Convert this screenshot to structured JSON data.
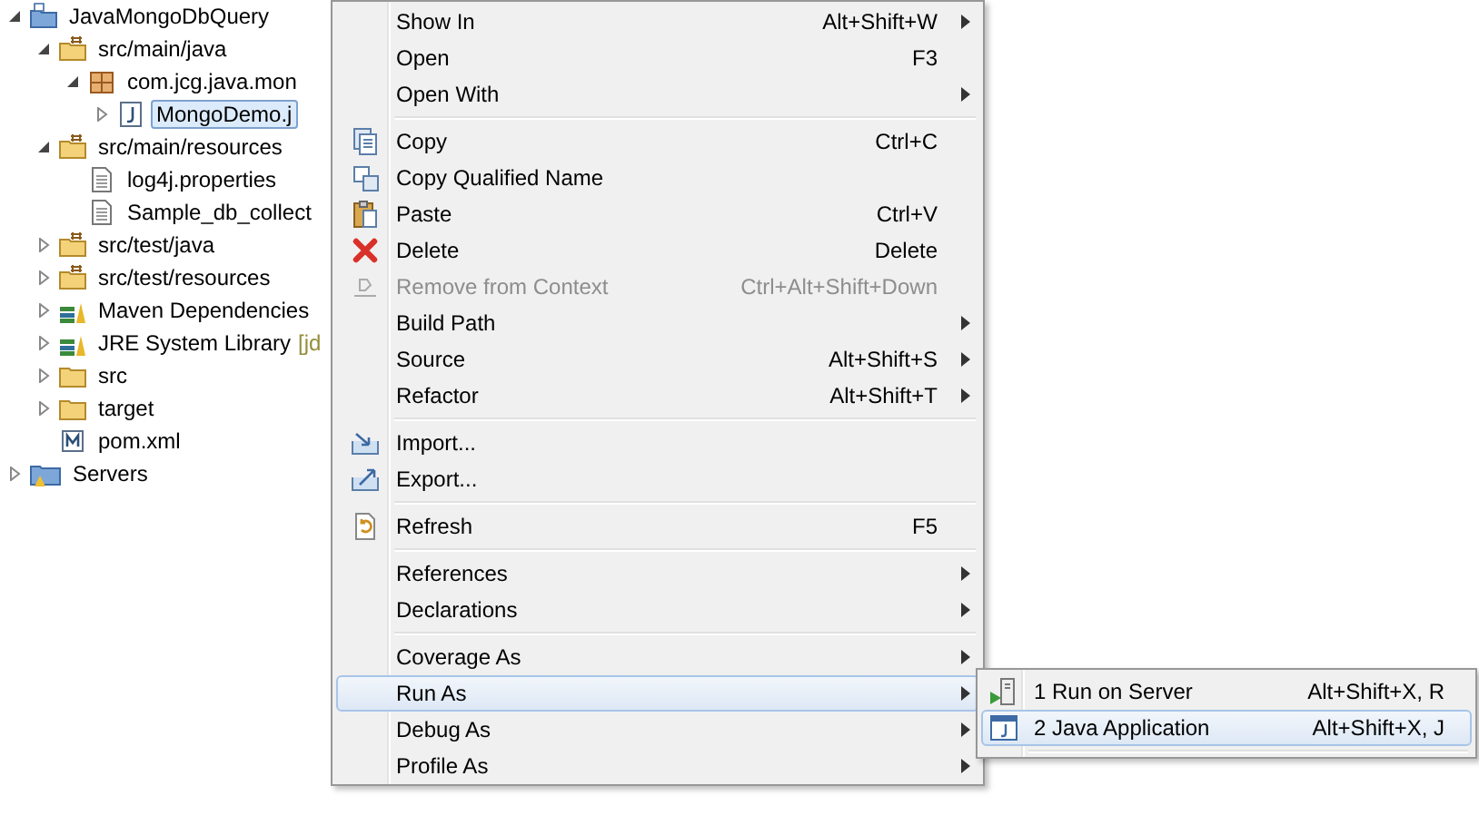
{
  "tree": [
    {
      "label": "JavaMongoDbQuery",
      "kind": "project",
      "expanded": true,
      "selected": false,
      "children": [
        {
          "label": "src/main/java",
          "kind": "source-folder",
          "expanded": true,
          "selected": false,
          "children": [
            {
              "label": "com.jcg.java.mon",
              "kind": "package",
              "expanded": true,
              "selected": false,
              "children": [
                {
                  "label": "MongoDemo.j",
                  "kind": "java-file",
                  "expanded": false,
                  "selected": true
                }
              ]
            }
          ]
        },
        {
          "label": "src/main/resources",
          "kind": "source-folder",
          "expanded": true,
          "selected": false,
          "children": [
            {
              "label": "log4j.properties",
              "kind": "file",
              "selected": false
            },
            {
              "label": "Sample_db_collect",
              "kind": "file",
              "selected": false
            }
          ]
        },
        {
          "label": "src/test/java",
          "kind": "source-folder",
          "expanded": false,
          "selected": false
        },
        {
          "label": "src/test/resources",
          "kind": "source-folder",
          "expanded": false,
          "selected": false
        },
        {
          "label": "Maven Dependencies",
          "kind": "library",
          "expanded": false,
          "selected": false
        },
        {
          "label": "JRE System Library",
          "decoration": "[jd",
          "kind": "library",
          "expanded": false,
          "selected": false
        },
        {
          "label": "src",
          "kind": "folder",
          "expanded": false,
          "selected": false
        },
        {
          "label": "target",
          "kind": "folder",
          "expanded": false,
          "selected": false
        },
        {
          "label": "pom.xml",
          "kind": "maven-file",
          "selected": false
        }
      ]
    },
    {
      "label": "Servers",
      "kind": "servers",
      "expanded": false,
      "selected": false
    }
  ],
  "context_menu": [
    {
      "kind": "plain",
      "label": "Show In",
      "shortcut": "Alt+Shift+W",
      "submenu": true,
      "disabled": false,
      "selected": false
    },
    {
      "kind": "plain",
      "label": "Open",
      "shortcut": "F3",
      "submenu": false,
      "disabled": false,
      "selected": false
    },
    {
      "kind": "plain",
      "label": "Open With",
      "submenu": true,
      "disabled": false,
      "selected": false
    },
    {
      "kind": "separator"
    },
    {
      "kind": "copy",
      "label": "Copy",
      "shortcut": "Ctrl+C",
      "submenu": false,
      "disabled": false,
      "selected": false
    },
    {
      "kind": "copy-qualified",
      "label": "Copy Qualified Name",
      "submenu": false,
      "disabled": false,
      "selected": false
    },
    {
      "kind": "paste",
      "label": "Paste",
      "shortcut": "Ctrl+V",
      "submenu": false,
      "disabled": false,
      "selected": false
    },
    {
      "kind": "delete",
      "label": "Delete",
      "shortcut": "Delete",
      "submenu": false,
      "disabled": false,
      "selected": false
    },
    {
      "kind": "remove-context",
      "label": "Remove from Context",
      "shortcut": "Ctrl+Alt+Shift+Down",
      "submenu": false,
      "disabled": true,
      "selected": false
    },
    {
      "kind": "plain",
      "label": "Build Path",
      "submenu": true,
      "disabled": false,
      "selected": false
    },
    {
      "kind": "plain",
      "label": "Source",
      "shortcut": "Alt+Shift+S",
      "submenu": true,
      "disabled": false,
      "selected": false
    },
    {
      "kind": "plain",
      "label": "Refactor",
      "shortcut": "Alt+Shift+T",
      "submenu": true,
      "disabled": false,
      "selected": false
    },
    {
      "kind": "separator"
    },
    {
      "kind": "import",
      "label": "Import...",
      "submenu": false,
      "disabled": false,
      "selected": false
    },
    {
      "kind": "export",
      "label": "Export...",
      "submenu": false,
      "disabled": false,
      "selected": false
    },
    {
      "kind": "separator"
    },
    {
      "kind": "refresh",
      "label": "Refresh",
      "shortcut": "F5",
      "submenu": false,
      "disabled": false,
      "selected": false
    },
    {
      "kind": "separator"
    },
    {
      "kind": "plain",
      "label": "References",
      "submenu": true,
      "disabled": false,
      "selected": false
    },
    {
      "kind": "plain",
      "label": "Declarations",
      "submenu": true,
      "disabled": false,
      "selected": false
    },
    {
      "kind": "separator"
    },
    {
      "kind": "plain",
      "label": "Coverage As",
      "submenu": true,
      "disabled": false,
      "selected": false
    },
    {
      "kind": "plain",
      "label": "Run As",
      "submenu": true,
      "disabled": false,
      "selected": true
    },
    {
      "kind": "plain",
      "label": "Debug As",
      "submenu": true,
      "disabled": false,
      "selected": false
    },
    {
      "kind": "plain",
      "label": "Profile As",
      "submenu": true,
      "disabled": false,
      "selected": false
    }
  ],
  "run_as_submenu": [
    {
      "kind": "server-run",
      "label": "1 Run on Server",
      "shortcut": "Alt+Shift+X, R",
      "selected": false
    },
    {
      "kind": "java-app",
      "label": "2 Java Application",
      "shortcut": "Alt+Shift+X, J",
      "selected": true
    },
    {
      "kind": "separator"
    }
  ]
}
